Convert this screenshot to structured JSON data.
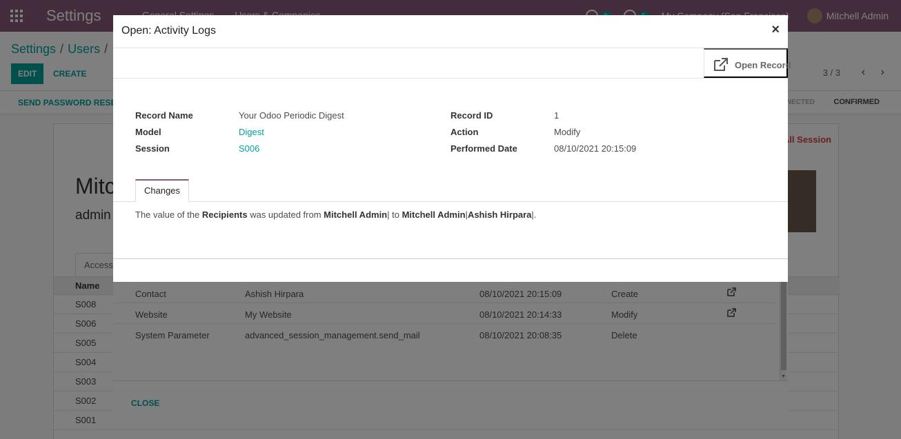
{
  "app": {
    "brand": "Settings",
    "menu": [
      "General Settings",
      "Users & Companies"
    ],
    "systray": {
      "activity_count": "9",
      "message_count": "5",
      "company": "My Company (San Francisco)",
      "user": "Mitchell Admin"
    }
  },
  "control_panel": {
    "breadcrumb": [
      "Settings",
      "Users"
    ],
    "edit_label": "EDIT",
    "create_label": "CREATE",
    "pager": "3 / 3"
  },
  "statusbar": {
    "send_password_label": "SEND PASSWORD RESE",
    "state_connected": "NECTED",
    "state_confirmed": "CONFIRMED"
  },
  "sheet": {
    "name": "Mitc",
    "login": "admin",
    "kill_all_label": "All Session",
    "tab_label": "Access",
    "column_name": "Name",
    "sessions": [
      "S008",
      "S006",
      "S005",
      "S004",
      "S003",
      "S002",
      "S001"
    ]
  },
  "outer_dialog": {
    "logs": [
      {
        "model": "Contact",
        "record": "Ashish Hirpara",
        "date": "08/10/2021 20:15:09",
        "action": "Create"
      },
      {
        "model": "Website",
        "record": "My Website",
        "date": "08/10/2021 20:14:33",
        "action": "Modify"
      },
      {
        "model": "System Parameter",
        "record": "advanced_session_management.send_mail",
        "date": "08/10/2021 20:08:35",
        "action": "Delete"
      }
    ],
    "close_label": "CLOSE"
  },
  "modal": {
    "title": "Open: Activity Logs",
    "close_symbol": "×",
    "open_record_label": "Open Record",
    "fields": {
      "record_name_label": "Record Name",
      "record_name": "Your Odoo Periodic Digest",
      "model_label": "Model",
      "model": "Digest",
      "session_label": "Session",
      "session": "S006",
      "record_id_label": "Record ID",
      "record_id": "1",
      "action_label": "Action",
      "action": "Modify",
      "performed_date_label": "Performed Date",
      "performed_date": "08/10/2021 20:15:09"
    },
    "tab_changes": "Changes",
    "changes": {
      "t1": "The value of the ",
      "field": "Recipients",
      "t2": " was updated from ",
      "old": "Mitchell Admin",
      "t3": "| to ",
      "new1": "Mitchell Admin",
      "t4": "|",
      "new2": "Ashish Hirpara",
      "t5": "|."
    }
  },
  "colors": {
    "brand": "#875a7b",
    "accent": "#00a09d",
    "danger": "#d23f3a"
  }
}
